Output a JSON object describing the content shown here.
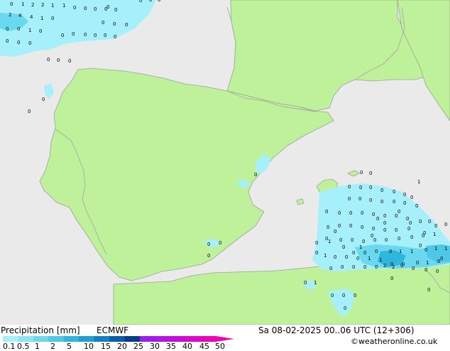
{
  "legend": {
    "title": "Precipitation [mm]",
    "model": "ECMWF",
    "datetime": "Sa 08-02-2025 00..06 UTC (12+306)",
    "credit": "©weatheronline.co.uk",
    "scale_labels": [
      "0.1",
      "0.5",
      "1",
      "2",
      "5",
      "10",
      "15",
      "20",
      "25",
      "30",
      "35",
      "40",
      "45",
      "50"
    ],
    "scale_colors": [
      "#a6f0fc",
      "#8ae6f6",
      "#6ad8ee",
      "#4ec8e6",
      "#30b6dc",
      "#1ea0d4",
      "#1280c2",
      "#0a5ea8",
      "#063c8c",
      "#9a1ef0",
      "#b414e6",
      "#cc0ad8",
      "#e006cc",
      "#f000b8"
    ]
  },
  "map_labels": {
    "north_cells": [
      "0",
      "1",
      "2",
      "2",
      "1",
      "1",
      "0",
      "0",
      "0",
      "0",
      "0",
      "2",
      "4",
      "4",
      "1",
      "0",
      "0",
      "0",
      "0",
      "0",
      "0",
      "1",
      "0",
      "0",
      "0",
      "0",
      "0",
      "0",
      "0",
      "0",
      "0",
      "0",
      "0",
      "0",
      "0",
      "0",
      "0",
      "0",
      "0",
      "0",
      "0"
    ],
    "south_cells": [
      "0",
      "0",
      "1",
      "0",
      "0",
      "0",
      "0",
      "0",
      "0",
      "0",
      "0",
      "0",
      "0",
      "0",
      "0",
      "0",
      "0",
      "0",
      "0",
      "0",
      "0",
      "0",
      "0",
      "0",
      "0",
      "0",
      "0",
      "0",
      "0",
      "0",
      "0",
      "0",
      "0",
      "0",
      "0",
      "0",
      "0",
      "1",
      "0",
      "0",
      "0",
      "0",
      "0",
      "0",
      "0",
      "0",
      "1",
      "0",
      "0",
      "0",
      "0",
      "1",
      "1",
      "0",
      "1",
      "1",
      "1",
      "0",
      "0",
      "0",
      "1",
      "1",
      "0",
      "0",
      "0",
      "1",
      "0",
      "0",
      "0",
      "0",
      "0",
      "0",
      "2",
      "2",
      "0",
      "0",
      "0",
      "0",
      "0",
      "1",
      "0",
      "0",
      "0",
      "0",
      "0",
      "0",
      "0",
      "0",
      "0",
      "0",
      "0",
      "0",
      "0",
      "0",
      "1",
      "0",
      "0",
      "0",
      "0",
      "0",
      "0",
      "0",
      "0",
      "0"
    ]
  },
  "colors": {
    "land": "#bff19b",
    "sea": "#eaeaea",
    "border": "#a8a8a8",
    "coast": "#9aa39a"
  }
}
